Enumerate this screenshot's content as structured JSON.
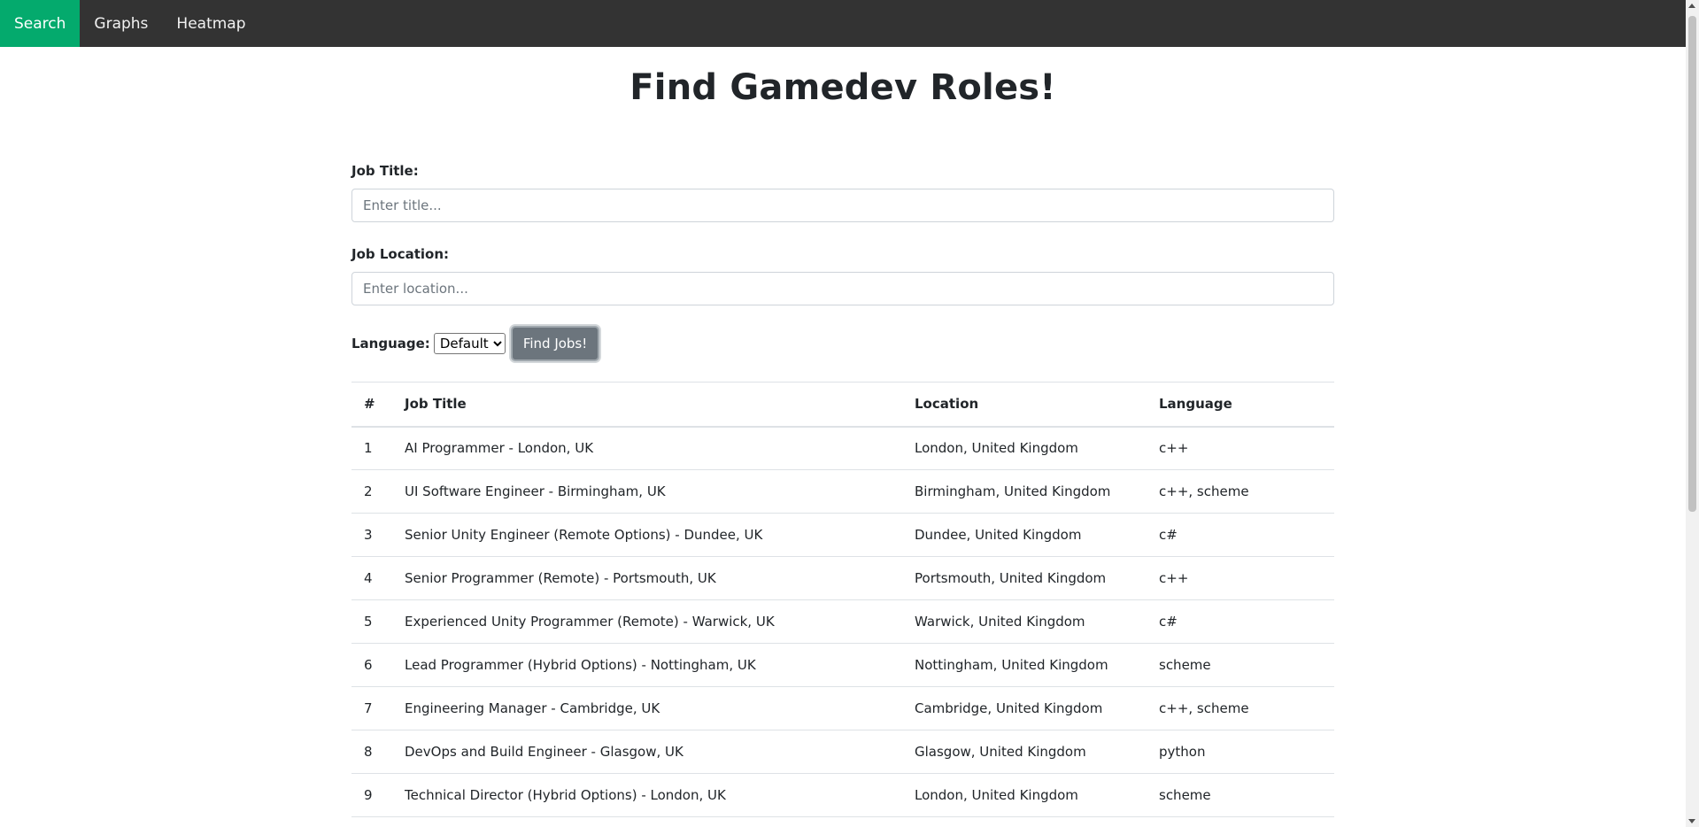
{
  "nav": {
    "items": [
      {
        "label": "Search",
        "active": true
      },
      {
        "label": "Graphs",
        "active": false
      },
      {
        "label": "Heatmap",
        "active": false
      }
    ]
  },
  "page": {
    "title": "Find Gamedev Roles!"
  },
  "form": {
    "job_title_label": "Job Title:",
    "job_title_placeholder": "Enter title...",
    "job_location_label": "Job Location:",
    "job_location_placeholder": "Enter location...",
    "language_label": "Language:",
    "language_selected": "Default",
    "find_button_label": "Find Jobs!"
  },
  "table": {
    "headers": [
      "#",
      "Job Title",
      "Location",
      "Language"
    ],
    "rows": [
      [
        "1",
        "AI Programmer - London, UK",
        "London, United Kingdom",
        "c++"
      ],
      [
        "2",
        "UI Software Engineer - Birmingham, UK",
        "Birmingham, United Kingdom",
        "c++, scheme"
      ],
      [
        "3",
        "Senior Unity Engineer (Remote Options) - Dundee, UK",
        "Dundee, United Kingdom",
        "c#"
      ],
      [
        "4",
        "Senior Programmer (Remote) - Portsmouth, UK",
        "Portsmouth, United Kingdom",
        "c++"
      ],
      [
        "5",
        "Experienced Unity Programmer (Remote) - Warwick, UK",
        "Warwick, United Kingdom",
        "c#"
      ],
      [
        "6",
        "Lead Programmer (Hybrid Options) - Nottingham, UK",
        "Nottingham, United Kingdom",
        "scheme"
      ],
      [
        "7",
        "Engineering Manager - Cambridge, UK",
        "Cambridge, United Kingdom",
        "c++, scheme"
      ],
      [
        "8",
        "DevOps and Build Engineer - Glasgow, UK",
        "Glasgow, United Kingdom",
        "python"
      ],
      [
        "9",
        "Technical Director (Hybrid Options) - London, UK",
        "London, United Kingdom",
        "scheme"
      ]
    ]
  },
  "colors": {
    "navbar_bg": "#333333",
    "nav_active_bg": "#04aa6d",
    "button_bg": "#6c757d"
  }
}
